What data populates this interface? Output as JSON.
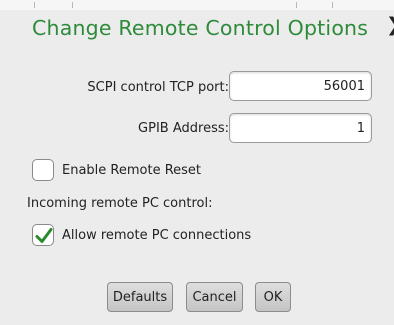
{
  "dialog": {
    "title": "Change Remote Control Options"
  },
  "fields": {
    "scpi_label": "SCPI control TCP port:",
    "scpi_value": "56001",
    "gpib_label": "GPIB Address:",
    "gpib_value": "1"
  },
  "options": {
    "enable_remote_reset": {
      "label": "Enable Remote Reset",
      "checked": false
    },
    "incoming_heading": "Incoming remote PC control:",
    "allow_remote_pc": {
      "label": "Allow remote PC connections",
      "checked": true
    }
  },
  "buttons": {
    "defaults": "Defaults",
    "cancel": "Cancel",
    "ok": "OK"
  },
  "icons": {
    "close": "close-icon",
    "check": "checkmark-icon"
  },
  "colors": {
    "title": "#2e8b3a",
    "check": "#2b8a2b"
  }
}
